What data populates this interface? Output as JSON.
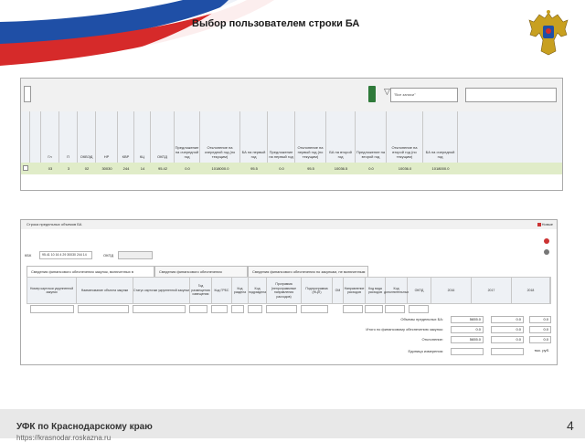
{
  "slide": {
    "title": "Выбор пользователем строки БА",
    "footer_text": "УФК по Краснодарскому краю",
    "footer_sub": "https://krasnodar.roskazna.ru",
    "page_number": "4"
  },
  "grid": {
    "filter_value": "\"Все записи\"",
    "columns": [
      "Гл",
      "П",
      "ОКВЭД",
      "НР",
      "КВР",
      "КЦ",
      "ОКПД",
      "Предложение на очередной год",
      "Отклонение на очередной год (по текущим)",
      "БА на первый год",
      "Предложение на первый год",
      "Отклонение на первый год (по текущим)",
      "БА на второй год",
      "Предложение на второй год",
      "Отклонение на второй год (по текущим)",
      "БА на очередной год"
    ],
    "row": [
      "03",
      "3",
      "02",
      "30030",
      "244",
      "14",
      "95.42",
      "0.0",
      "1018000.0",
      "95.5",
      "0.0",
      "95.5",
      "10036.5",
      "0.0",
      "10036.0",
      "1018000.0"
    ]
  },
  "detail": {
    "window_title": "Строка предельных объемов БА",
    "close_label": "Новые",
    "kbk_label": "КБК",
    "kbk_value": "95.41 10 16 4 29 30030 244 14",
    "okpd_label": "ОКПД",
    "tabs": [
      "Сведения финансового обеспечения закупок, включенных в предложение",
      "Сведения финансового обеспечения утвержденных закупок",
      "Сведения финансового обеспечения по закупкам, не включенным в предложение"
    ],
    "columns": [
      "Номер карточки укрупненной закупки",
      "Наименование объекта закупки",
      "Статус карточки укрупненной закупки",
      "Год размещения извещения",
      "Код ГРБС",
      "Код раздела",
      "Код подраздела",
      "Программа (непрограммные направления расходов)",
      "Подпрограмма (НЦП)",
      "ОМ",
      "Направление расходов",
      "Код вида расходов",
      "Код дополнительных",
      "ОКПД",
      "2016",
      "2017",
      "2018"
    ],
    "summary": [
      {
        "label": "Объемы предельных БА:",
        "v2016": "5655.0",
        "v2017": "0.0",
        "v2018": "0.0"
      },
      {
        "label": "Итого по финансовому обеспечению закупок:",
        "v2016": "0.0",
        "v2017": "0.0",
        "v2018": "0.0"
      },
      {
        "label": "Отклонение:",
        "v2016": "5655.0",
        "v2017": "0.0",
        "v2018": "0.0"
      },
      {
        "label": "Единица измерения:",
        "v2016": "",
        "v2017": "",
        "v2018": "тыс. руб."
      }
    ]
  }
}
